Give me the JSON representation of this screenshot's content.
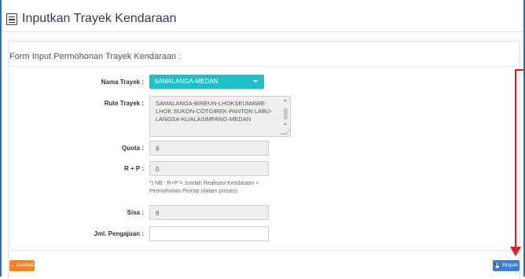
{
  "page": {
    "title": "Inputkan Trayek Kendaraan",
    "icon": "list-icon"
  },
  "form": {
    "heading": "Form Input Permohonan Trayek Kendaraan :",
    "fields": {
      "nama_trayek": {
        "label": "Nama Trayek :",
        "value": "SAMALANGA-MEDAN"
      },
      "rute_trayek": {
        "label": "Rute Trayek :",
        "value": "SAMALANGA-BIREUN-LHOKSEUMAWE-LHOK SUKON-COTGIREK-PANTON LABU-LANGSA-KUALASIMPANG-MEDAN"
      },
      "quota": {
        "label": "Quota :",
        "value": "6"
      },
      "rp": {
        "label": "R + P :",
        "value": "0",
        "note": "*) NB : R+P = Jumlah Realisasi Kendaraan + Permohonan Prinsip (dalam proses)"
      },
      "sisa": {
        "label": "Sisa :",
        "value": "6"
      },
      "jml_pengajuan": {
        "label": "Jml. Pengajuan :",
        "value": ""
      }
    }
  },
  "buttons": {
    "back": {
      "label": "Kembali",
      "icon": "arrow-left-icon",
      "color": "#f58220"
    },
    "save": {
      "label": "Simpan",
      "icon": "save-icon",
      "color": "#3b7dd8"
    }
  },
  "colors": {
    "select_bg": "#1fbfc7",
    "annotation_arrow": "#e8191d",
    "frame": "#2f6db5"
  }
}
